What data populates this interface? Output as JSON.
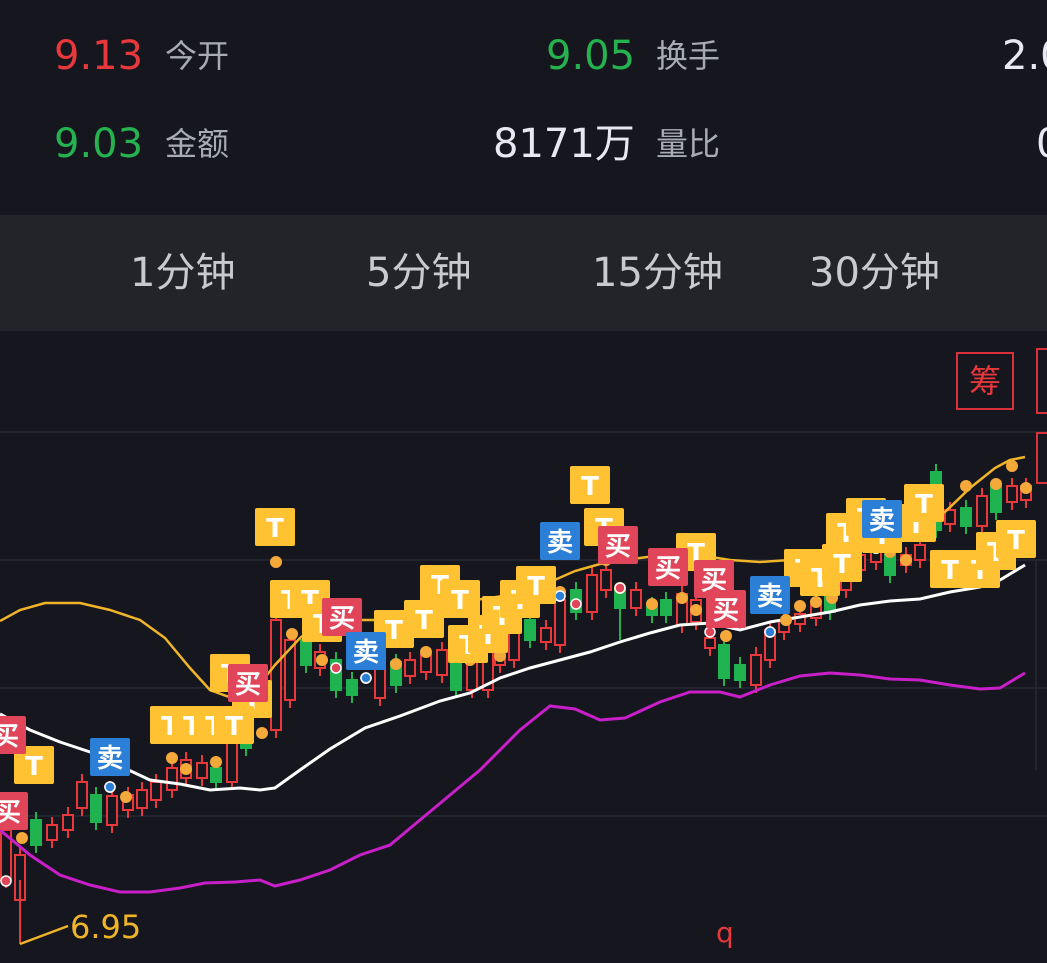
{
  "quote": {
    "row1": {
      "v1": "9.13",
      "l1": "今开",
      "v2": "9.05",
      "l2": "换手",
      "v3": "2.0"
    },
    "row2": {
      "v1": "9.03",
      "l1": "金额",
      "v2": "8171万",
      "l2": "量比",
      "v3": "0"
    }
  },
  "tabs": [
    "1分钟",
    "5分钟",
    "15分钟",
    "30分钟"
  ],
  "chip_button": "筹",
  "chart_data": {
    "type": "candlestick",
    "low_marker": "6.95",
    "bottom_marker": "q",
    "badges": {
      "buy": "买",
      "sell": "卖",
      "t": "T"
    },
    "colors": {
      "up": "#e8383b",
      "down": "#1fb24e",
      "ma_short": "#f0b429",
      "ma_mid": "#ffffff",
      "ma_long": "#c81fc9",
      "t_badge": "#ffc232",
      "buy_badge": "#e0455a",
      "sell_badge": "#2c7fd6"
    },
    "grid": true
  }
}
